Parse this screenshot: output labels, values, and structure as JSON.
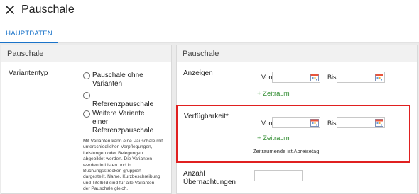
{
  "header": {
    "title": "Pauschale"
  },
  "tabs": [
    {
      "label": "HAUPTDATEN"
    }
  ],
  "left_panel": {
    "title": "Pauschale",
    "variant_type_label": "Variantentyp",
    "options": {
      "opt1_line1": "Pauschale ohne",
      "opt1_line2": "Varianten",
      "opt2_line1": "Referenzpauschale",
      "opt3_line1": "Weitere Variante",
      "opt3_line2": "einer",
      "opt3_line3": "Referenzpauschale"
    },
    "help": [
      "Mit Varianten kann eine Pauschale mit",
      "unterschiedlichen Verpflegungen,",
      "Leistungen oder Belegungen",
      "abgebildet werden. Die Varianten",
      "werden in Listen und in",
      "Buchungsstrecken gruppiert",
      "dargestellt. Name, Kurzbeschreibung",
      "und Titelbild sind für alle Varianten",
      "der Pauschale gleich."
    ]
  },
  "right_panel": {
    "title": "Pauschale",
    "anzeigen": {
      "label": "Anzeigen",
      "von": "Von",
      "bis": "Bis",
      "von_value": "",
      "bis_value": "",
      "add_link": "+ Zeitraum"
    },
    "verfuegbarkeit": {
      "label": "Verfügbarkeit*",
      "von": "Von",
      "bis": "Bis",
      "von_value": "",
      "bis_value": "",
      "add_link": "+ Zeitraum",
      "note": "Zeitraumende ist Abreisetag."
    },
    "uebernachtungen": {
      "label_line1": "Anzahl",
      "label_line2": "Übernachtungen",
      "value": ""
    }
  },
  "colors": {
    "accent": "#1a73c9",
    "link": "#2e8b2e",
    "highlight": "#e02020"
  },
  "icons": {
    "close": "close-icon",
    "calendar": "calendar-icon"
  }
}
